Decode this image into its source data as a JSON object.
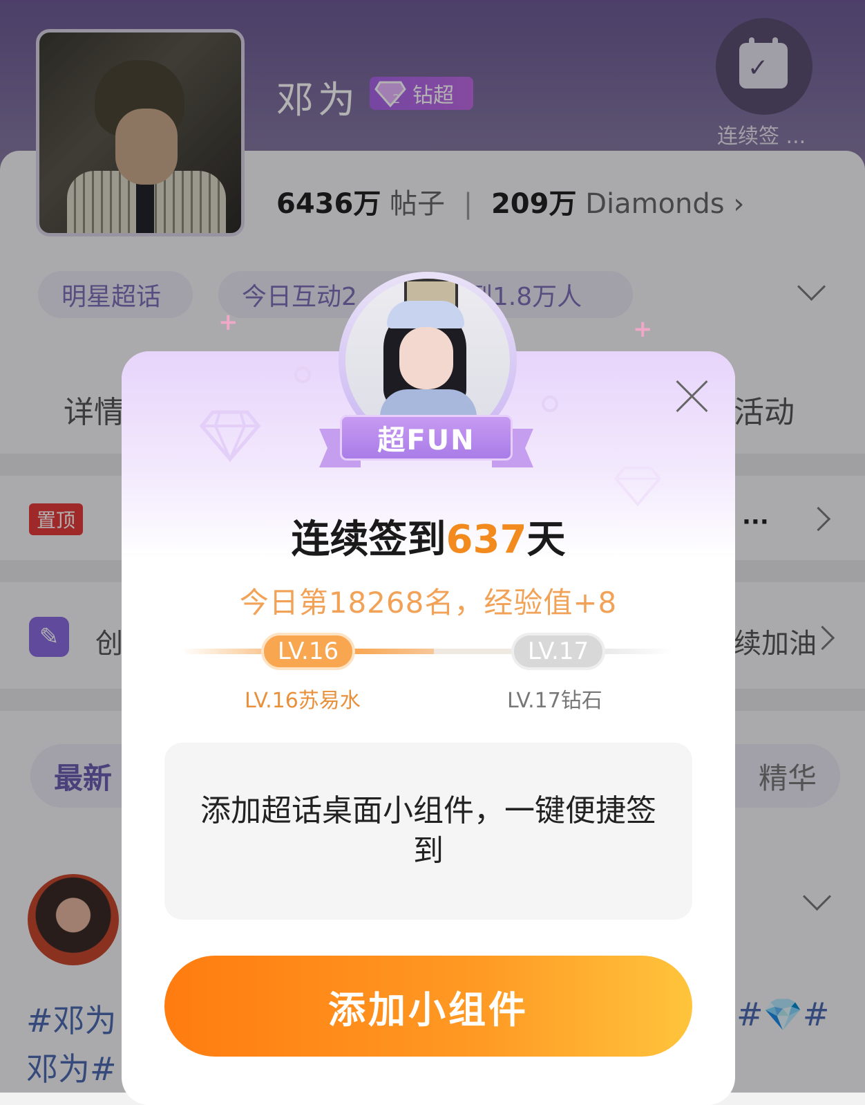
{
  "profile": {
    "name": "邓为",
    "badge_label": "钻超",
    "badge_level": "2",
    "checkin_label": "连续签 ...",
    "posts_count": "6436万",
    "posts_unit": "帖子",
    "diamonds_count": "209万",
    "diamonds_unit": "Diamonds"
  },
  "pills": {
    "topic": "明星超话",
    "interaction": "今日互动2",
    "signed": "到1.8万人"
  },
  "tabs": {
    "details_partial": "详情",
    "activity_partial": "活动"
  },
  "rows": {
    "pin_label": "置顶",
    "create_partial": "创",
    "cheer_partial": "续加油"
  },
  "filters": {
    "latest_partial": "最新",
    "essence_partial": "精华"
  },
  "post": {
    "hashtag_line1": "#邓为",
    "hashtag_line2": "邓为#",
    "hashtag_right": "#💎#"
  },
  "modal": {
    "ribbon_label": "超FUN",
    "streak_prefix": "连续签到",
    "streak_days": "637",
    "streak_suffix": "天",
    "rank_text": "今日第18268名，经验值+8",
    "current_level": "LV.16",
    "next_level": "LV.17",
    "current_level_name": "LV.16苏易水",
    "next_level_name": "LV.17钻石",
    "level_progress": 0.5,
    "widget_prompt": "添加超话桌面小组件，一键便捷签到",
    "cta_label": "添加小组件"
  },
  "colors": {
    "accent_orange": "#f28a1e",
    "level_orange": "#f9a650",
    "purple": "#a97ce8",
    "header_purple": "#6d5a96"
  }
}
